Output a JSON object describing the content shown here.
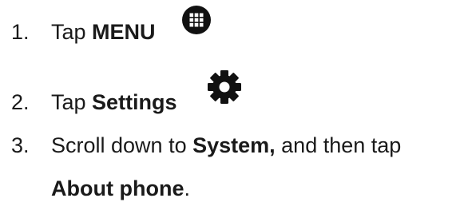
{
  "steps": [
    {
      "number": "1.",
      "prefix": "Tap ",
      "bold": "MENU",
      "icon": "menu-grid-icon"
    },
    {
      "number": "2.",
      "prefix": "Tap ",
      "bold": "Settings",
      "icon": "gear-icon"
    },
    {
      "number": "3.",
      "prefix": "Scroll down to ",
      "bold": "System,",
      "suffix": " and then tap",
      "bold2": "About phone",
      "suffix2": "."
    }
  ],
  "colors": {
    "text": "#1a1a1a",
    "icon": "#111111"
  }
}
